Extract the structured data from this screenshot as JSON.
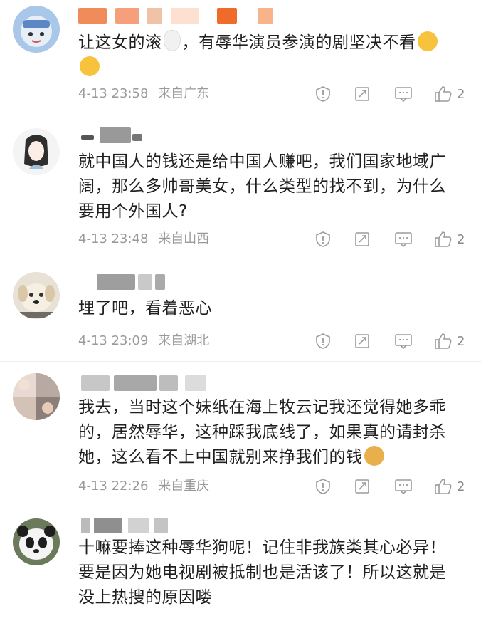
{
  "comments": [
    {
      "text": "让这女的滚🥚，有辱华演员参演的剧坚决不看😤😤",
      "text_parts": [
        "让这女的滚",
        "，有辱华演员参演的剧坚决不看",
        ""
      ],
      "date": "4-13 23:58",
      "location": "来自广东",
      "likes": "2",
      "avatar_icon": "cartoon-blue-avatar"
    },
    {
      "text": "就中国人的钱还是给中国人赚吧，我们国家地域广阔，那么多帅哥美女，什么类型的找不到，为什么要用个外国人?",
      "date": "4-13 23:48",
      "location": "来自山西",
      "likes": "2",
      "avatar_icon": "ink-girl-avatar"
    },
    {
      "text": "埋了吧，看着恶心",
      "date": "4-13 23:09",
      "location": "来自湖北",
      "likes": "2",
      "avatar_icon": "dog-avatar"
    },
    {
      "text_parts": [
        "我去，当时这个妹纸在海上牧云记我还觉得她多乖的，居然辱华，这种踩我底线了，如果真的请封杀她，这么看不上中国就别来挣我们的钱",
        ""
      ],
      "date": "4-13 22:26",
      "location": "来自重庆",
      "likes": "2",
      "avatar_icon": "photo-collage-avatar"
    },
    {
      "text": "十嘛要捧这种辱华狗呢！记住非我族类其心必异！要是因为她电视剧被抵制也是活该了！所以这就是没上热搜的原因喽",
      "avatar_icon": "panda-avatar"
    }
  ],
  "colors": {
    "meta_gray": "#9a9a9a",
    "icon_gray": "#9b9b9b",
    "divider": "#ededed",
    "emoji_yellow": "#f7c33c"
  },
  "icons": [
    "report-icon",
    "forward-icon",
    "comment-icon",
    "like-icon"
  ]
}
